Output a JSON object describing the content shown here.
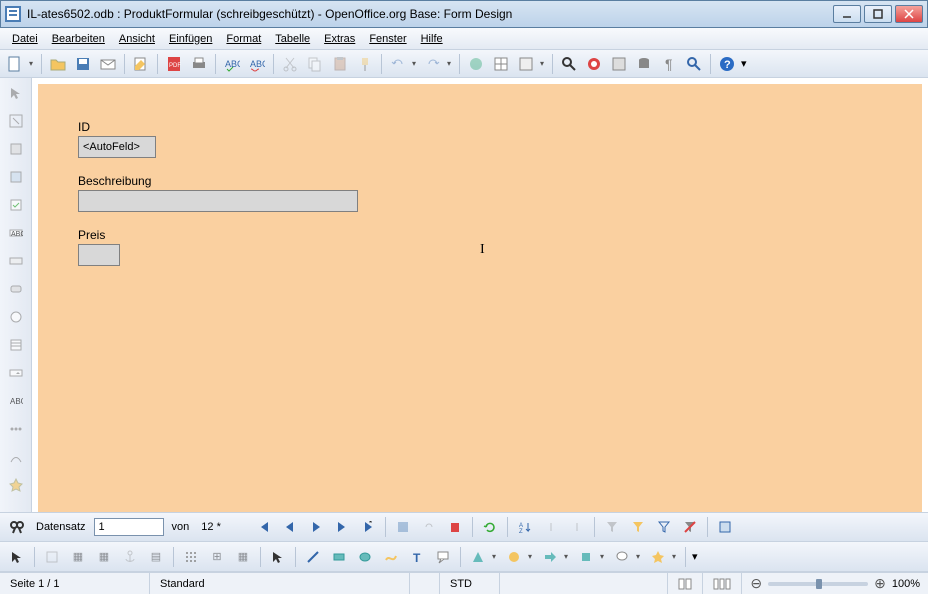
{
  "window": {
    "title": "IL-ates6502.odb : ProduktFormular (schreibgeschützt) - OpenOffice.org Base: Form Design"
  },
  "menu": {
    "items": [
      "Datei",
      "Bearbeiten",
      "Ansicht",
      "Einfügen",
      "Format",
      "Tabelle",
      "Extras",
      "Fenster",
      "Hilfe"
    ]
  },
  "form": {
    "id_label": "ID",
    "id_value": "<AutoFeld>",
    "desc_label": "Beschreibung",
    "desc_value": "",
    "price_label": "Preis",
    "price_value": ""
  },
  "recordnav": {
    "record_label": "Datensatz",
    "current": "1",
    "of_label": "von",
    "total": "12 *"
  },
  "status": {
    "page": "Seite 1 / 1",
    "style": "Standard",
    "lang": "",
    "mode": "STD",
    "zoom_minus": "⊖",
    "zoom_plus": "⊕",
    "zoom_pct": "100%"
  },
  "icons": {
    "binoculars": "🔍",
    "help": "?"
  }
}
